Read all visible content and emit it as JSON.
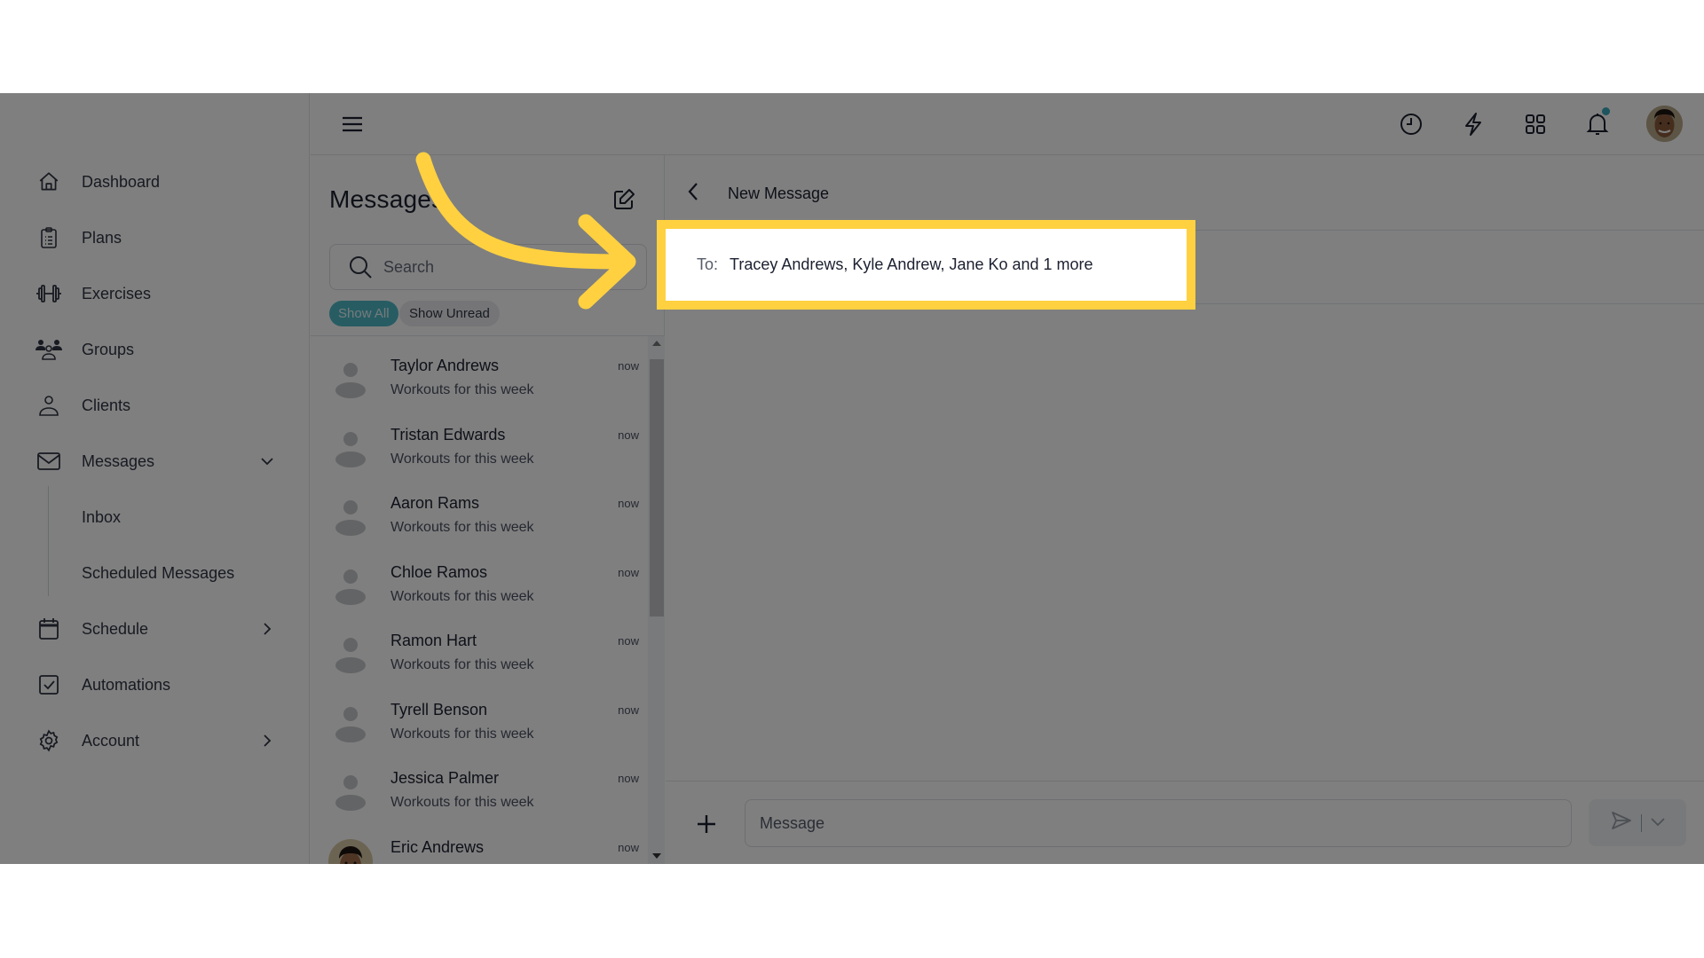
{
  "sidebar": {
    "items": [
      {
        "label": "Dashboard",
        "icon": "home-icon"
      },
      {
        "label": "Plans",
        "icon": "clipboard-icon"
      },
      {
        "label": "Exercises",
        "icon": "dumbbell-icon"
      },
      {
        "label": "Groups",
        "icon": "users-icon"
      },
      {
        "label": "Clients",
        "icon": "user-icon"
      },
      {
        "label": "Messages",
        "icon": "mail-icon",
        "expanded": true
      },
      {
        "label": "Schedule",
        "icon": "calendar-icon"
      },
      {
        "label": "Automations",
        "icon": "checkbox-icon"
      },
      {
        "label": "Account",
        "icon": "gear-icon"
      }
    ],
    "messages_sub": [
      {
        "label": "Inbox"
      },
      {
        "label": "Scheduled Messages"
      }
    ]
  },
  "topbar": {
    "icons": [
      "history-icon",
      "lightning-icon",
      "apps-grid-icon",
      "bell-icon"
    ],
    "notification_dot_color": "#3aa8bd"
  },
  "messages_panel": {
    "title": "Messages",
    "search_placeholder": "Search",
    "filters": [
      {
        "label": "Show All",
        "active": true
      },
      {
        "label": "Show Unread",
        "active": false
      }
    ],
    "conversations": [
      {
        "name": "Taylor Andrews",
        "preview": "Workouts for this week",
        "time": "now"
      },
      {
        "name": "Tristan Edwards",
        "preview": "Workouts for this week",
        "time": "now"
      },
      {
        "name": "Aaron Rams",
        "preview": "Workouts for this week",
        "time": "now"
      },
      {
        "name": "Chloe Ramos",
        "preview": "Workouts for this week",
        "time": "now"
      },
      {
        "name": "Ramon Hart",
        "preview": "Workouts for this week",
        "time": "now"
      },
      {
        "name": "Tyrell Benson",
        "preview": "Workouts for this week",
        "time": "now"
      },
      {
        "name": "Jessica Palmer",
        "preview": "Workouts for this week",
        "time": "now"
      },
      {
        "name": "Eric Andrews",
        "preview": "",
        "time": "now"
      }
    ]
  },
  "conversation": {
    "title": "New Message",
    "to_label": "To:",
    "to_value": "Tracey Andrews, Kyle Andrew, Jane Ko and 1 more",
    "message_placeholder": "Message"
  },
  "annotation": {
    "highlight_color": "#ffd140"
  }
}
